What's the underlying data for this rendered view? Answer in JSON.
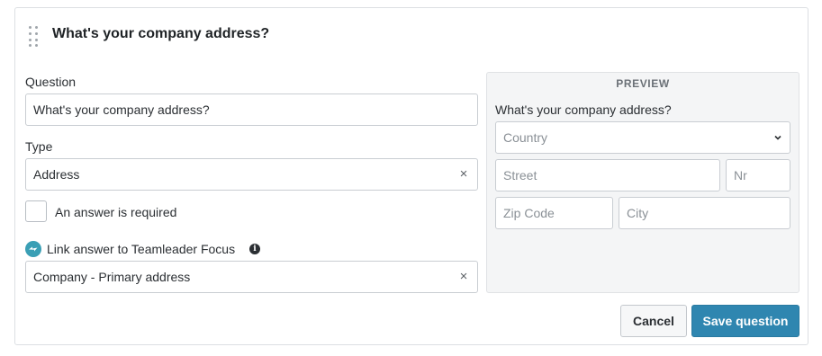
{
  "header": {
    "title": "What's your company address?"
  },
  "question": {
    "label": "Question",
    "value": "What's your company address?"
  },
  "type": {
    "label": "Type",
    "value": "Address"
  },
  "required": {
    "label": "An answer is required",
    "checked": false
  },
  "link": {
    "label": "Link answer to Teamleader Focus",
    "value": "Company - Primary address"
  },
  "preview": {
    "heading": "PREVIEW",
    "question": "What's your company address?",
    "country_placeholder": "Country",
    "street_placeholder": "Street",
    "nr_placeholder": "Nr",
    "zip_placeholder": "Zip Code",
    "city_placeholder": "City"
  },
  "actions": {
    "cancel_label": "Cancel",
    "save_label": "Save question"
  },
  "colors": {
    "primary": "#2f86b0",
    "link_icon": "#3a9fb5",
    "preview_bg": "#f4f5f6"
  }
}
